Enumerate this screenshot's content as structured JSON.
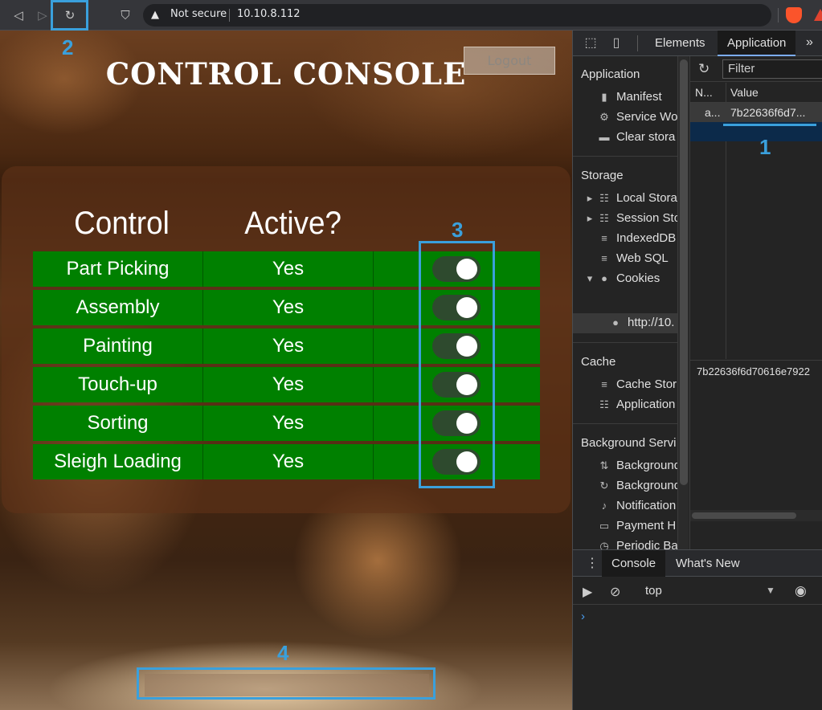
{
  "browser": {
    "security_label": "Not secure",
    "url": "10.10.8.112"
  },
  "page": {
    "title": "CONTROL CONSOLE",
    "logout_label": "Logout",
    "table": {
      "headers": [
        "Control",
        "Active?"
      ],
      "rows": [
        {
          "control": "Part Picking",
          "active": "Yes",
          "enabled": true
        },
        {
          "control": "Assembly",
          "active": "Yes",
          "enabled": true
        },
        {
          "control": "Painting",
          "active": "Yes",
          "enabled": true
        },
        {
          "control": "Touch-up",
          "active": "Yes",
          "enabled": true
        },
        {
          "control": "Sorting",
          "active": "Yes",
          "enabled": true
        },
        {
          "control": "Sleigh Loading",
          "active": "Yes",
          "enabled": true
        }
      ]
    }
  },
  "annotations": {
    "labels": [
      "1",
      "2",
      "3",
      "4"
    ],
    "color": "#3aa0dc"
  },
  "devtools": {
    "tabs": [
      "Elements",
      "Application"
    ],
    "active_tab": "Application",
    "sidebar": {
      "application_section": "Application",
      "application_items": [
        "Manifest",
        "Service Wo",
        "Clear stora"
      ],
      "storage_section": "Storage",
      "storage_items": [
        "Local Stora",
        "Session Sto",
        "IndexedDB",
        "Web SQL",
        "Cookies",
        "http://10."
      ],
      "cache_section": "Cache",
      "cache_items": [
        "Cache Stor",
        "Application"
      ],
      "bg_section": "Background Servi",
      "bg_items": [
        "Background",
        "Background",
        "Notification",
        "Payment H",
        "Periodic Ba"
      ]
    },
    "filter_placeholder": "Filter",
    "grid": {
      "name_header": "N...",
      "value_header": "Value",
      "row_name": "a...",
      "row_value": "7b22636f6d7..."
    },
    "value_preview": "7b22636f6d70616e7922",
    "drawer_tabs": [
      "Console",
      "What's New"
    ],
    "console_context": "top",
    "console_prompt": "›"
  },
  "colors": {
    "row_green": "#008000",
    "annotation_blue": "#3aa0dc"
  }
}
